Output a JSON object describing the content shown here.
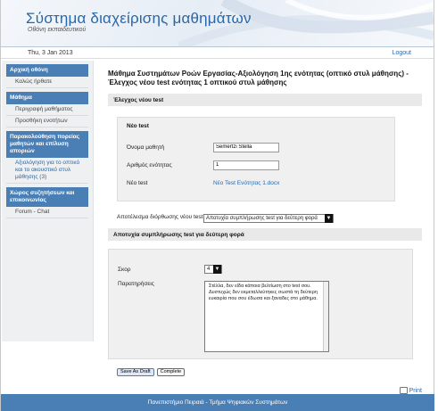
{
  "header": {
    "title": "Σύστημα διαχείρισης μαθημάτων",
    "subtitle": "Οθόνη εκπαιδευτικού"
  },
  "datebar": {
    "date": "Thu, 3 Jan 2013",
    "logout": "Logout"
  },
  "sidebar": {
    "groups": [
      {
        "heading": "Αρχική οθόνη",
        "items": [
          "Καλώς ήρθατε"
        ]
      },
      {
        "heading": "Μάθημα",
        "items": [
          "Περιγραφή μαθήματος",
          "Προσθήκη ενοτήτων"
        ]
      },
      {
        "heading": "Παρακολούθηση πορείας μαθητών και επίλυση αποριών",
        "items": [
          "Αξιολόγηση για το οπτικό και το ακουστικό στυλ μάθησης (3)"
        ]
      },
      {
        "heading": "Χώρος συζητήσεων και επικοινωνίας",
        "items": [
          "Forum - Chat"
        ]
      }
    ]
  },
  "main": {
    "lesson_title": "Μάθημα Συστημάτων Ροών Εργασίας-Αξιολόγηση 1ης ενότητας (οπτικό στυλ μάθησης) - Έλεγχος νέου test ενότητας 1 οπτικού στυλ μάθησης",
    "section1": "Έλεγχος νέου test",
    "panel_title": "Νέο test",
    "student_label": "Όνομα μαθητή",
    "student_value": "Semertzi Stella",
    "unit_label": "Αριθμός ενότητας",
    "unit_value": "1",
    "test_label": "Νέο test",
    "test_file": "Νέο Test Ενότητας 1.docx",
    "result_label": "Αποτέλεσμα διόρθωσης νέου test",
    "result_value": "Αποτυχία συμπλήρωσης test για δεύτερη φορά",
    "section2": "Αποτυχία συμπλήρωσης test για δεύτερη φορά",
    "score_label": "Σκορ",
    "score_value": "4",
    "comments_label": "Παρατηρήσεις",
    "comments_value": "Στέλλα, δεν είδα κάποια βελτίωση στο test σου. Δυστυχώς δεν εκμεταλλεύτηκες σωστά τη δεύτερη ευκαιρία που σου έδωσα και ξαναδες στο μάθημα.",
    "save_label": "Save As Draft",
    "complete_label": "Complete",
    "print_label": "Print"
  },
  "footer": {
    "text": "Πανεπιστήμιο Πειραιά - Τμήμα Ψηφιακών Συστημάτων"
  },
  "colors": {
    "accent": "#4a7fb6",
    "title_blue": "#2a67a8",
    "panel_gray": "#f0f0f0"
  }
}
